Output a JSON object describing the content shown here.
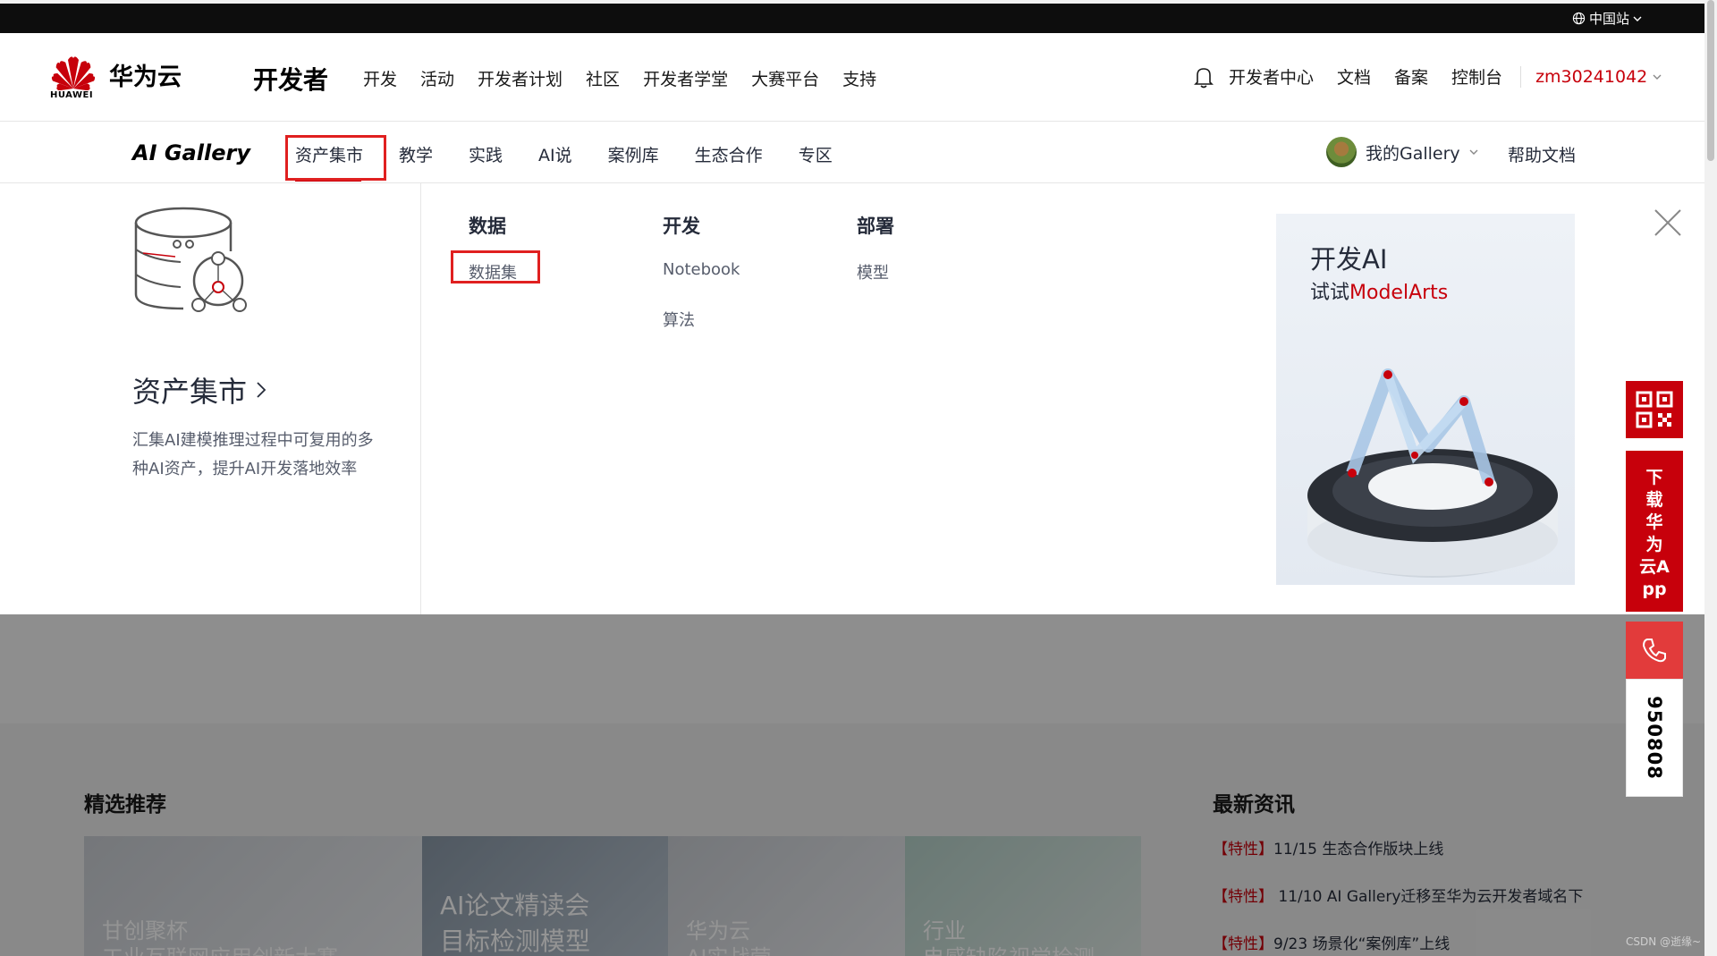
{
  "topbar": {
    "region_label": "中国站"
  },
  "header": {
    "logo_text": "华为云",
    "logo_sub": "HUAWEI",
    "section_title": "开发者",
    "nav": [
      "开发",
      "活动",
      "开发者计划",
      "社区",
      "开发者学堂",
      "大赛平台",
      "支持"
    ],
    "right_nav": {
      "dev_center": "开发者中心",
      "docs": "文档",
      "filing": "备案",
      "console": "控制台",
      "username": "zm30241042"
    }
  },
  "subnav": {
    "brand": "AI Gallery",
    "items": [
      "资产集市",
      "教学",
      "实践",
      "AI说",
      "案例库",
      "生态合作",
      "专区"
    ],
    "active_item": "资产集市",
    "my_gallery": "我的Gallery",
    "help_docs": "帮助文档"
  },
  "dropdown": {
    "title": "资产集市",
    "description": "汇集AI建模推理过程中可复用的多种AI资产，提升AI开发落地效率",
    "columns": [
      {
        "heading": "数据",
        "links": [
          "数据集"
        ]
      },
      {
        "heading": "开发",
        "links": [
          "Notebook",
          "算法"
        ]
      },
      {
        "heading": "部署",
        "links": [
          "模型"
        ]
      }
    ],
    "promo": {
      "title": "开发AI",
      "sub_prefix": "试试",
      "sub_brand": "ModelArts"
    }
  },
  "lower": {
    "featured_title": "精选推荐",
    "cards": [
      {
        "line1": "甘创聚杯",
        "line2": "工业互联网应用创新大赛"
      },
      {
        "line1": "AI论文精读会",
        "line2": "目标检测模型"
      },
      {
        "line1": "华为云",
        "line2": "AI实战营"
      },
      {
        "line1": "行业",
        "line2": "电感缺陷视觉检测"
      }
    ],
    "news_title": "最新资讯",
    "news": [
      {
        "tag": "【特性】",
        "text": "11/15 生态合作版块上线"
      },
      {
        "tag": "【特性】",
        "text": " 11/10 AI Gallery迁移至华为云开发者域名下"
      },
      {
        "tag": "【特性】",
        "text": "9/23 场景化“案例库”上线"
      }
    ]
  },
  "float_bar": {
    "app_label": "下载华为云App",
    "phone_number": "950808"
  },
  "watermark": "CSDN @逝缘~",
  "colors": {
    "brand_red": "#c7000b",
    "highlight_box": "#e02020",
    "topbar": "#0d0d0d"
  }
}
